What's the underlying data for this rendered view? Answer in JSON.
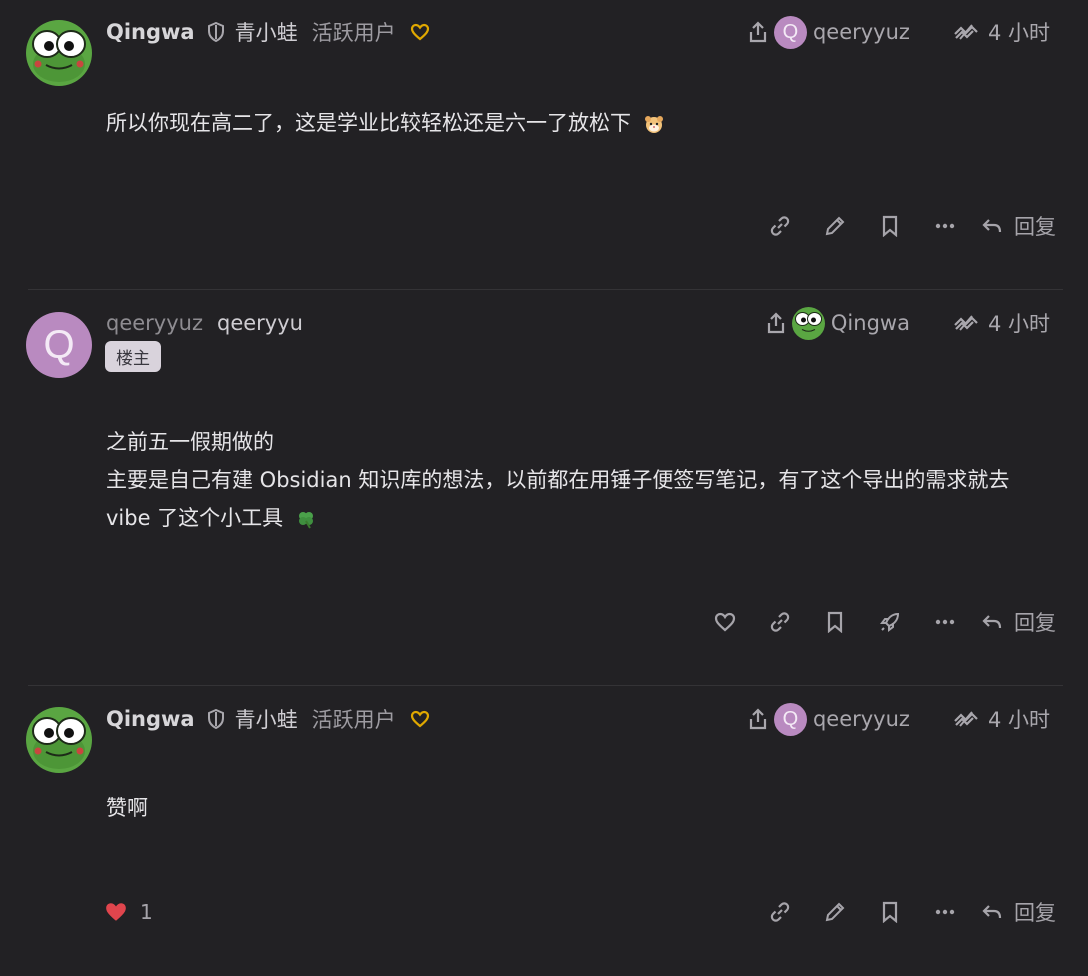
{
  "posts": [
    {
      "username": "Qingwa",
      "full_name": "青小蛙",
      "user_title": "活跃用户",
      "reply_to": "qeeryyuz",
      "reply_to_avatar_letter": "Q",
      "time": "4 小时",
      "body_lines": [
        "所以你现在高二了，这是学业比较轻松还是六一了放松下"
      ],
      "reply_label": "回复"
    },
    {
      "username": "qeeryyuz",
      "full_name": "qeeryyu",
      "avatar_letter": "Q",
      "badge": "楼主",
      "reply_to": "Qingwa",
      "time": "4 小时",
      "body_lines": [
        "之前五一假期做的",
        "主要是自己有建 Obsidian 知识库的想法，以前都在用锤子便签写笔记，有了这个导出的需求就去",
        "vibe 了这个小工具"
      ],
      "reply_label": "回复"
    },
    {
      "username": "Qingwa",
      "full_name": "青小蛙",
      "user_title": "活跃用户",
      "reply_to": "qeeryyuz",
      "reply_to_avatar_letter": "Q",
      "time": "4 小时",
      "body_lines": [
        "赞啊"
      ],
      "like_count": "1",
      "reply_label": "回复"
    }
  ],
  "colors": {
    "background": "#222124",
    "accent_heart": "#e0a800",
    "like_red": "#e0454d",
    "avatar_purple": "#b98ac0",
    "frog_green": "#5aa642"
  },
  "icons": {
    "moderator": "shield-icon",
    "flair": "heart-outline-icon",
    "reply_indicator": "share-icon",
    "history": "history-icon",
    "link": "link-icon",
    "edit": "pencil-icon",
    "bookmark": "bookmark-icon",
    "more": "ellipsis-icon",
    "like": "heart-icon",
    "boost": "rocket-icon",
    "reply": "reply-arrow-icon"
  }
}
